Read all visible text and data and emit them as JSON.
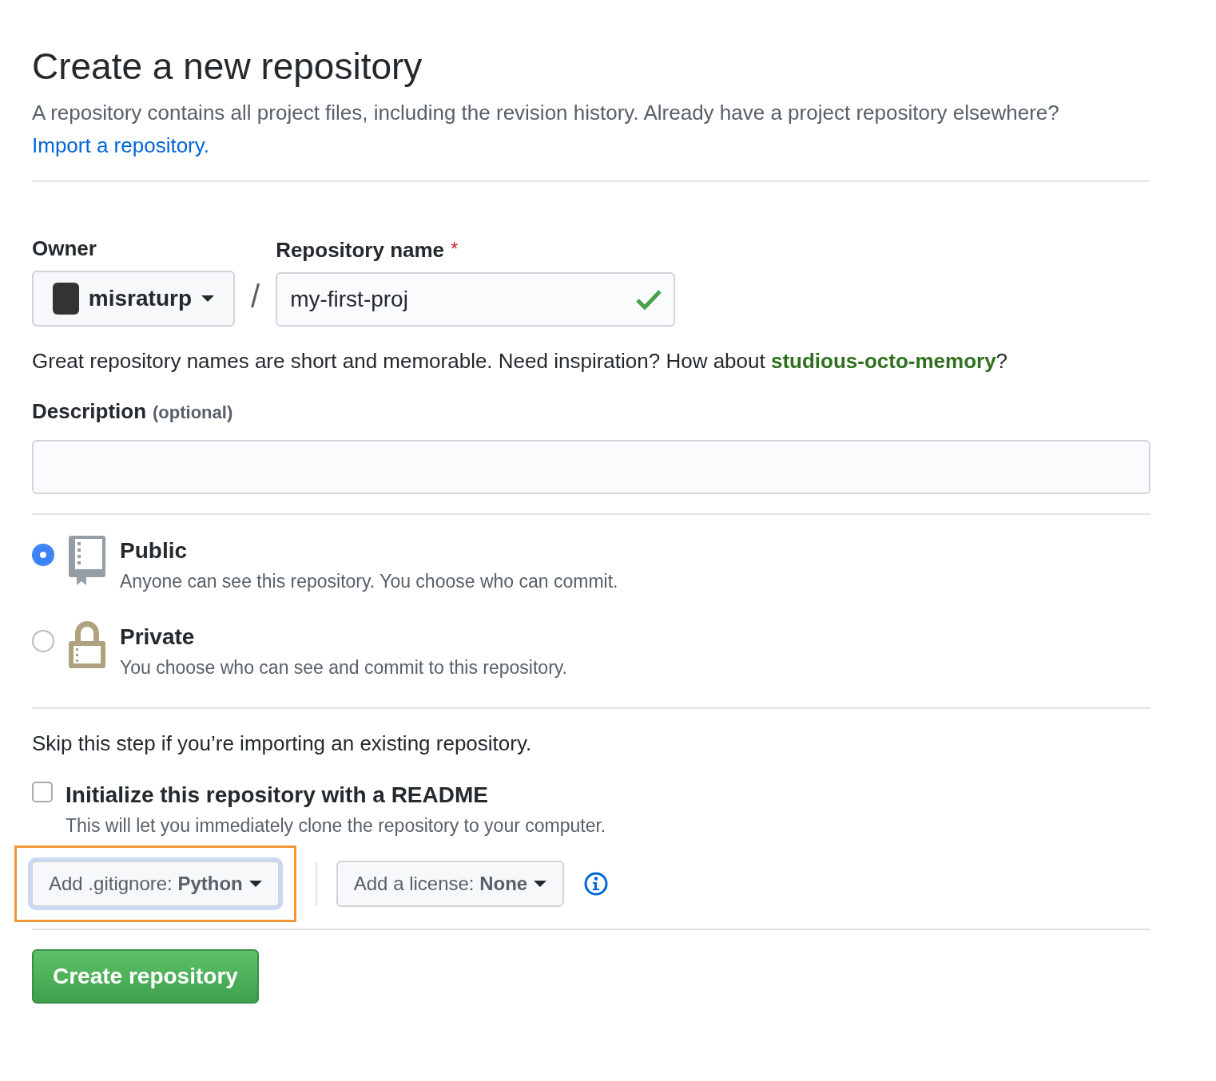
{
  "header": {
    "title": "Create a new repository",
    "intro": "A repository contains all project files, including the revision history. Already have a project repository elsewhere?",
    "import_link": "Import a repository."
  },
  "owner": {
    "label": "Owner",
    "value": "misraturp"
  },
  "separator": "/",
  "repo_name": {
    "label": "Repository name",
    "required_mark": "*",
    "value": "my-first-proj",
    "valid": true
  },
  "name_hint": "Great repository names are short and memorable. Need inspiration? How about **studious-octo-memory**?",
  "description": {
    "label": "Description",
    "note": "(optional)"
  },
  "visibility": [
    {
      "kind": "public",
      "title": "Public",
      "text": "Anyone can see this repository. You choose who can commit.",
      "selected": true
    },
    {
      "kind": "private",
      "title": "Private",
      "text": "You choose who can see and commit to this repository.",
      "selected": false
    }
  ],
  "init": {
    "skip_note": "Skip this step if you’re importing an existing repository.",
    "readme_label": "Initialize this repository with a README",
    "readme_text": "This will let you immediately clone the repository to your computer.",
    "checked": false
  },
  "dropdowns": [
    {
      "label": "Add .gitignore: **Python**",
      "highlighted": true
    },
    {
      "label": "Add a license: **None**",
      "highlighted": false
    }
  ],
  "submit": "Create repository"
}
